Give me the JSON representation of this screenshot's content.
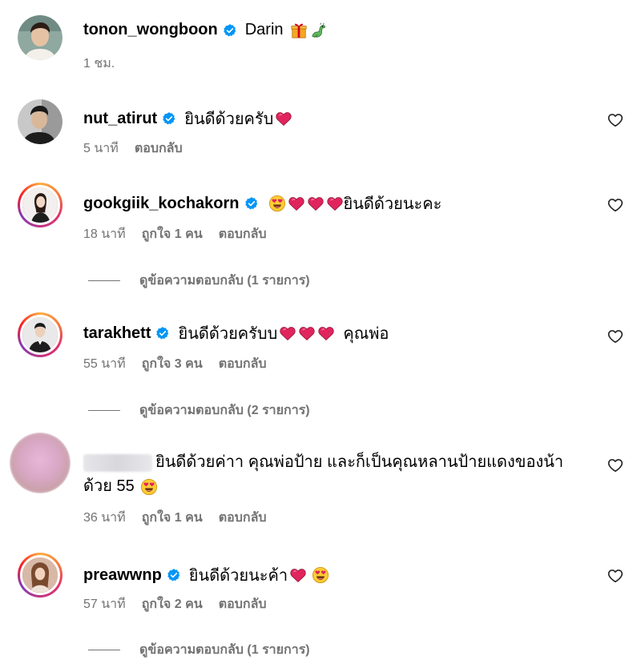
{
  "comments": [
    {
      "username": "tonon_wongboon",
      "text": "Darin",
      "emojis": [
        "gift-emoji",
        "dragon-emoji"
      ],
      "time": "1 ชม.",
      "likes": "",
      "reply": "",
      "view_replies": ""
    },
    {
      "username": "nut_atirut",
      "text": "ยินดีด้วยครับ",
      "emojis": [
        "red-heart-emoji"
      ],
      "time": "5 นาที",
      "likes": "",
      "reply": "ตอบกลับ",
      "view_replies": ""
    },
    {
      "username": "gookgiik_kochakorn",
      "text_after": "ยินดีด้วยนะคะ",
      "emojis": [
        "heart-eyes-emoji",
        "red-heart-emoji",
        "red-heart-emoji",
        "red-heart-emoji"
      ],
      "time": "18 นาที",
      "likes": "ถูกใจ 1 คน",
      "reply": "ตอบกลับ",
      "view_replies": "ดูข้อความตอบกลับ (1 รายการ)"
    },
    {
      "username": "tarakhett",
      "text": "ยินดีด้วยครับบ",
      "text_after": "คุณพ่อ",
      "emojis": [
        "red-heart-emoji",
        "red-heart-emoji",
        "red-heart-emoji"
      ],
      "time": "55 นาที",
      "likes": "ถูกใจ 3 คน",
      "reply": "ตอบกลับ",
      "view_replies": "ดูข้อความตอบกลับ (2 รายการ)"
    },
    {
      "username": "",
      "text": "ยินดีด้วยค่าา คุณพ่อป้าย และก็เป็นคุณหลานป้ายแดงของน้า",
      "text_line2": "ด้วย 55",
      "emojis": [
        "heart-eyes-emoji"
      ],
      "time": "36 นาที",
      "likes": "ถูกใจ 1 คน",
      "reply": "ตอบกลับ",
      "view_replies": ""
    },
    {
      "username": "preawwnp",
      "text": "ยินดีด้วยนะค้า",
      "emojis": [
        "red-heart-emoji",
        "heart-eyes-emoji"
      ],
      "time": "57 นาที",
      "likes": "ถูกใจ 2 คน",
      "reply": "ตอบกลับ",
      "view_replies": "ดูข้อความตอบกลับ (1 รายการ)"
    }
  ],
  "colors": {
    "text": "#000000",
    "secondary": "#737373",
    "verified": "#0095f6",
    "heart": "#e0245e"
  }
}
